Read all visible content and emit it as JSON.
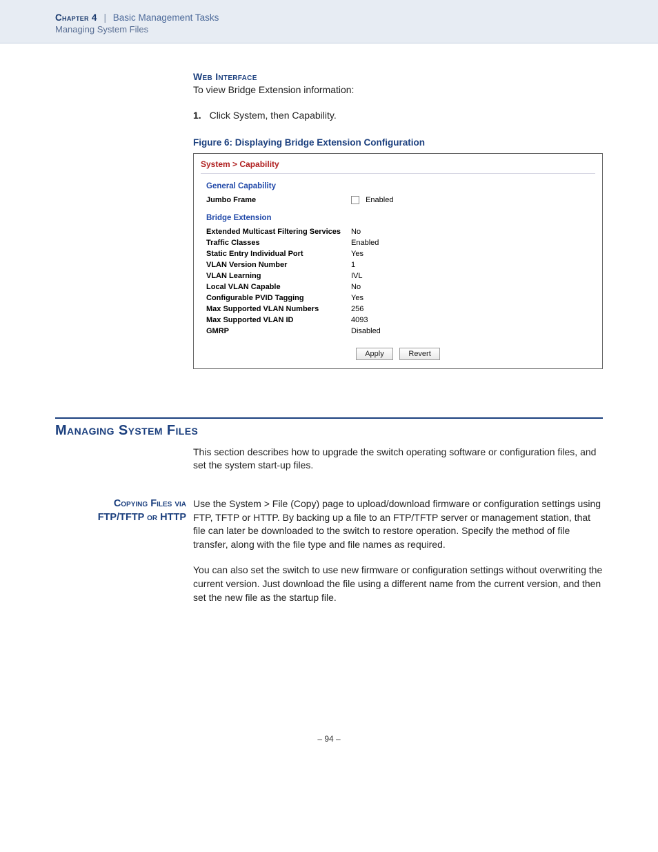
{
  "header": {
    "chapter_label": "Chapter 4",
    "separator": "|",
    "chapter_title": "Basic Management Tasks",
    "subtitle": "Managing System Files"
  },
  "web_interface": {
    "heading": "Web Interface",
    "intro": "To view Bridge Extension information:",
    "step_num": "1.",
    "step_text": "Click System, then Capability."
  },
  "figure": {
    "caption": "Figure 6:  Displaying Bridge Extension Configuration",
    "breadcrumb": "System > Capability",
    "general_title": "General Capability",
    "jumbo_label": "Jumbo Frame",
    "jumbo_value": "Enabled",
    "bridge_title": "Bridge Extension",
    "rows": [
      {
        "label": "Extended Multicast Filtering Services",
        "value": "No"
      },
      {
        "label": "Traffic Classes",
        "value": "Enabled"
      },
      {
        "label": "Static Entry Individual Port",
        "value": "Yes"
      },
      {
        "label": "VLAN Version Number",
        "value": "1"
      },
      {
        "label": "VLAN Learning",
        "value": "IVL"
      },
      {
        "label": "Local VLAN Capable",
        "value": "No"
      },
      {
        "label": "Configurable PVID Tagging",
        "value": "Yes"
      },
      {
        "label": "Max Supported VLAN Numbers",
        "value": "256"
      },
      {
        "label": "Max Supported VLAN ID",
        "value": "4093"
      },
      {
        "label": "GMRP",
        "value": "Disabled"
      }
    ],
    "apply": "Apply",
    "revert": "Revert"
  },
  "section": {
    "heading": "Managing System Files",
    "intro": "This section describes how to upgrade the switch operating software or configuration files, and set the system start-up files."
  },
  "subsection": {
    "side_heading_l1": "Copying Files via",
    "side_heading_l2": "FTP/TFTP or HTTP",
    "para1": "Use the System > File (Copy) page to upload/download firmware or configuration settings using FTP, TFTP or HTTP. By backing up a file to an FTP/TFTP server or management station, that file can later be downloaded to the switch to restore operation. Specify the method of file transfer, along with the file type and file names as required.",
    "para2": "You can also set the switch to use new firmware or configuration settings without overwriting the current version. Just download the file using a different name from the current version, and then set the new file as the startup file."
  },
  "page_number": "–  94  –"
}
